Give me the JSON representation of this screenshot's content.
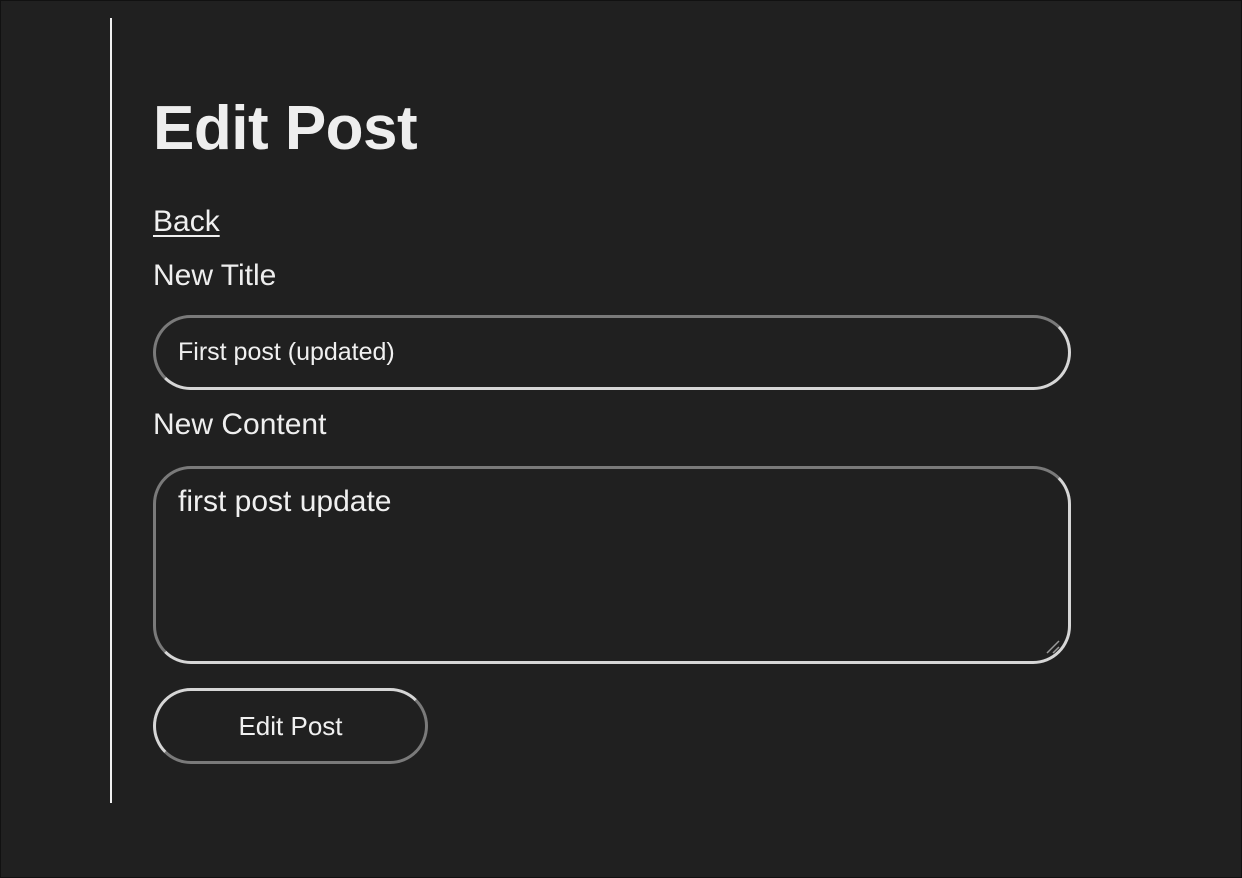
{
  "page": {
    "title": "Edit Post",
    "back_link": "Back"
  },
  "form": {
    "title_label": "New Title",
    "title_value": "First post (updated)",
    "content_label": "New Content",
    "content_value": "first post update",
    "submit_label": "Edit Post"
  },
  "colors": {
    "background": "#202020",
    "text": "#eeeeee",
    "border_light": "#d6d6d6",
    "border_dark": "#7a7a7a"
  },
  "icons": {
    "resize_grip": "resize-grip-icon"
  }
}
